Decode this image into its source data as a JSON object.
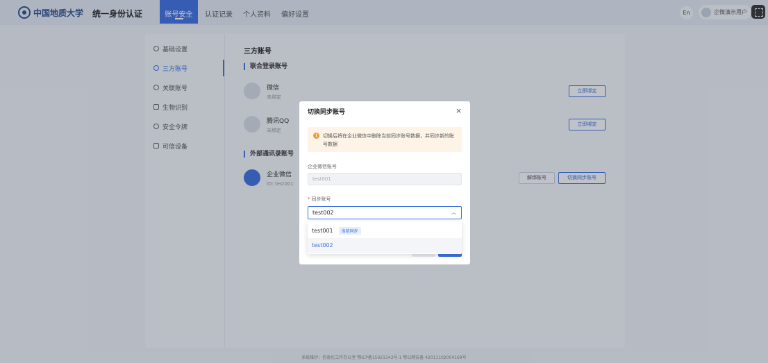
{
  "header": {
    "logo_text": "中国地质大学",
    "app_title": "统一身份认证",
    "tabs": [
      {
        "label": "账号安全",
        "active": true
      },
      {
        "label": "认证记录",
        "active": false
      },
      {
        "label": "个人资料",
        "active": false
      },
      {
        "label": "偏好设置",
        "active": false
      }
    ],
    "lang": "En",
    "user": "企微演示用户"
  },
  "sidebar": {
    "items": [
      {
        "label": "基础设置",
        "icon": "gear-icon"
      },
      {
        "label": "三方账号",
        "icon": "link-icon",
        "active": true
      },
      {
        "label": "关联账号",
        "icon": "ring-icon"
      },
      {
        "label": "生物识别",
        "icon": "scan-icon"
      },
      {
        "label": "安全令牌",
        "icon": "shield-icon"
      },
      {
        "label": "可信设备",
        "icon": "device-icon"
      }
    ]
  },
  "main": {
    "title": "三方账号",
    "section_login": "联合登录账号",
    "section_external": "外部通讯录账号",
    "accounts": [
      {
        "name": "微信",
        "status": "未绑定",
        "action": "立即绑定"
      },
      {
        "name": "腾讯QQ",
        "status": "未绑定",
        "action": "立即绑定"
      }
    ],
    "external": {
      "name": "企业微信",
      "id": "ID: test001",
      "unbind": "解绑账号",
      "switch": "切换同步账号"
    }
  },
  "footer": "系统维护：信息化工作办公室 鄂ICP备15021343号-1 鄂公网安备 42011102004169号",
  "modal": {
    "title": "切换同步账号",
    "close": "×",
    "warning": "切换后将在企业微信中删除当前同步账号数据，并同步新的账号数据",
    "field1_label": "企业微信账号",
    "field1_value": "test001",
    "field2_label": "同步账号",
    "selected": "test002",
    "options": [
      {
        "value": "test001",
        "tag": "当前同步"
      },
      {
        "value": "test002",
        "tag": ""
      }
    ]
  },
  "colors": {
    "accent": "#3c6fe0",
    "warning": "#f29b38"
  }
}
